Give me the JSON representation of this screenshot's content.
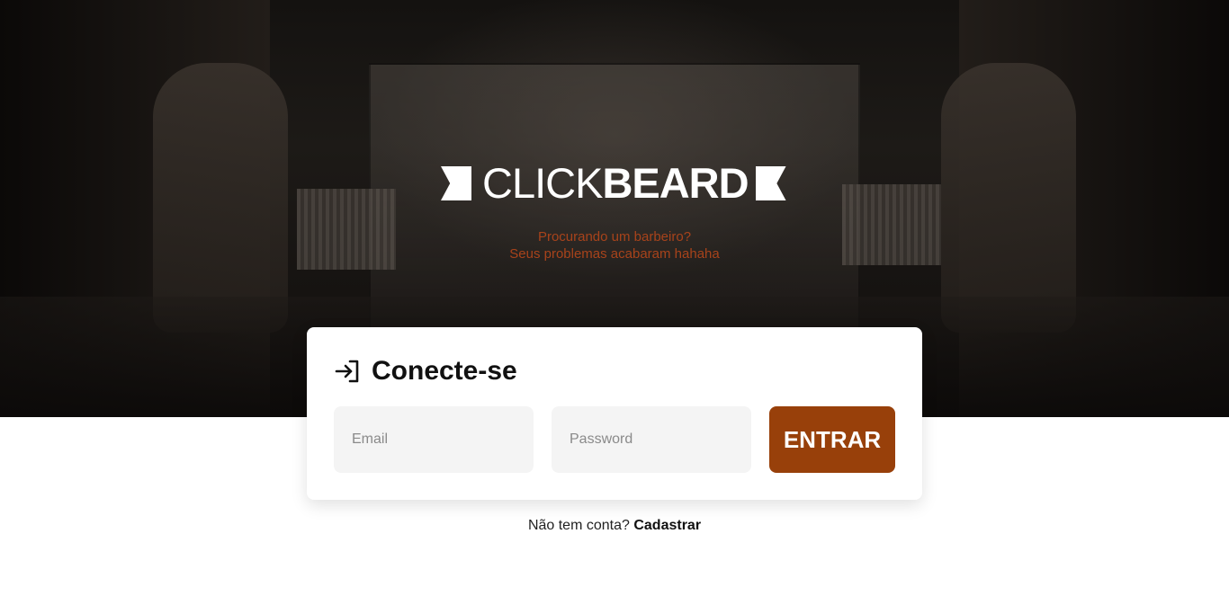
{
  "brand": {
    "name_light": "CLICK",
    "name_bold": "BEARD",
    "tagline_line1": "Procurando um barbeiro?",
    "tagline_line2": "Seus problemas acabaram hahaha",
    "accent_color": "#98400a"
  },
  "login": {
    "title": "Conecte-se",
    "title_icon": "login-arrow-icon",
    "email_placeholder": "Email",
    "password_placeholder": "Password",
    "submit_label": "ENTRAR"
  },
  "signup": {
    "prompt": "Não tem conta?",
    "link_label": "Cadastrar"
  }
}
